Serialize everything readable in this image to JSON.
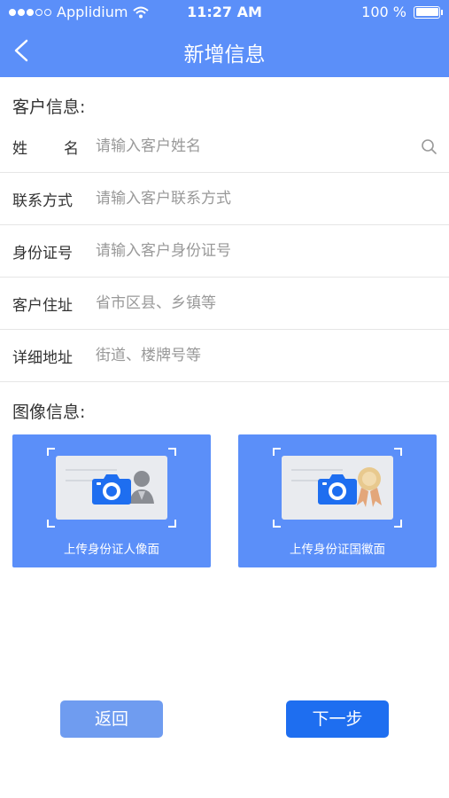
{
  "status_bar": {
    "carrier": "Applidium",
    "time": "11:27 AM",
    "battery": "100 %"
  },
  "nav": {
    "title": "新增信息"
  },
  "customer_section": {
    "title": "客户信息:"
  },
  "fields": {
    "name": {
      "label_a": "姓",
      "label_b": "名",
      "placeholder": "请输入客户姓名"
    },
    "contact": {
      "label": "联系方式",
      "placeholder": "请输入客户联系方式"
    },
    "id_number": {
      "label": "身份证号",
      "placeholder": "请输入客户身份证号"
    },
    "address": {
      "label": "客户住址",
      "placeholder": "省市区县、乡镇等"
    },
    "detail_address": {
      "label": "详细地址",
      "placeholder": "街道、楼牌号等"
    }
  },
  "image_section": {
    "title": "图像信息:"
  },
  "uploads": {
    "front": {
      "label": "上传身份证人像面",
      "icon": "camera-icon"
    },
    "back": {
      "label": "上传身份证国徽面",
      "icon": "camera-icon"
    }
  },
  "buttons": {
    "back": "返回",
    "next": "下一步"
  },
  "colors": {
    "primary": "#5b8ff9",
    "button_next": "#1e6ef0",
    "button_back": "#6f9cf0"
  }
}
